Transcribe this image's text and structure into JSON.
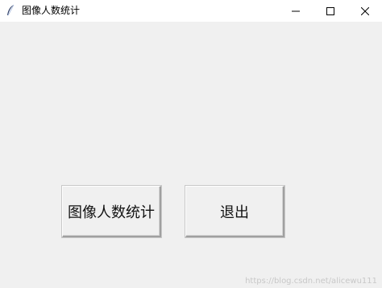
{
  "window": {
    "title": "图像人数统计",
    "icon": "feather-icon"
  },
  "controls": {
    "minimize_icon": "minimize-icon",
    "maximize_icon": "maximize-icon",
    "close_icon": "close-icon"
  },
  "buttons": {
    "stats_label": "图像人数统计",
    "exit_label": "退出"
  },
  "watermark": "https://blog.csdn.net/alicewu111"
}
